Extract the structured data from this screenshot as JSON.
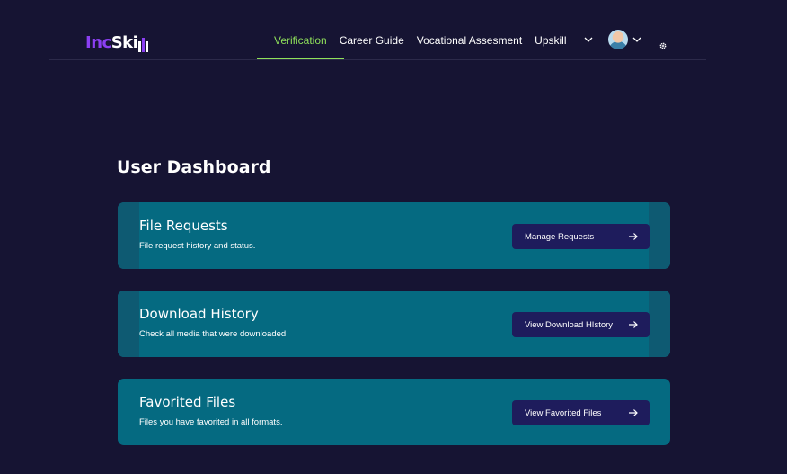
{
  "header": {
    "logo": {
      "prefix": "Inc",
      "suffix": "Ski"
    },
    "nav": [
      {
        "label": "Verification",
        "active": true
      },
      {
        "label": "Career Guide",
        "active": false
      },
      {
        "label": "Vocational Assesment",
        "active": false
      },
      {
        "label": "Upskill",
        "active": false
      }
    ],
    "icons": [
      "chevron-down-icon",
      "avatar",
      "chevron-down-icon",
      "gear-icon"
    ],
    "accent_color": "#8fe05a",
    "brand_color": "#8b3ff2"
  },
  "main": {
    "title": "User Dashboard",
    "cards": [
      {
        "title": "File Requests",
        "subtitle": "File request history and status.",
        "button": "Manage Requests"
      },
      {
        "title": "Download History",
        "subtitle": "Check all media that were downloaded",
        "button": "View Download HIstory"
      },
      {
        "title": "Favorited Files",
        "subtitle": "Files you have favorited in all formats.",
        "button": "View Favorited Files"
      }
    ],
    "card_color": "#056a81",
    "button_color": "#1e1c5c"
  }
}
